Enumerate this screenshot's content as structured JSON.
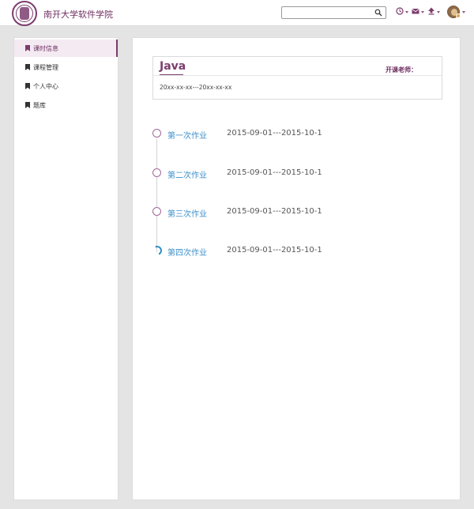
{
  "header": {
    "school_name": "南开大学软件学院",
    "search": {
      "value": "",
      "placeholder": ""
    },
    "icons": [
      "clock-icon",
      "mail-icon",
      "upload-icon"
    ],
    "avatar": "user-avatar"
  },
  "sidebar": {
    "items": [
      {
        "label": "课时信息",
        "active": true
      },
      {
        "label": "课程管理",
        "active": false
      },
      {
        "label": "个人中心",
        "active": false
      },
      {
        "label": "题库",
        "active": false
      }
    ]
  },
  "course": {
    "title": "Java",
    "teacher_label": "开课老师：",
    "dates": "20xx-xx-xx---20xx-xx-xx"
  },
  "assignments": [
    {
      "name": "第一次作业",
      "date": "2015-09-01---2015-10-1",
      "status": "open"
    },
    {
      "name": "第二次作业",
      "date": "2015-09-01---2015-10-1",
      "status": "open"
    },
    {
      "name": "第三次作业",
      "date": "2015-09-01---2015-10-1",
      "status": "open"
    },
    {
      "name": "第四次作业",
      "date": "2015-09-01---2015-10-1",
      "status": "in-progress"
    }
  ],
  "colors": {
    "brand": "#7b3d6e",
    "link": "#3d8fca",
    "background": "#e4e4e4"
  }
}
